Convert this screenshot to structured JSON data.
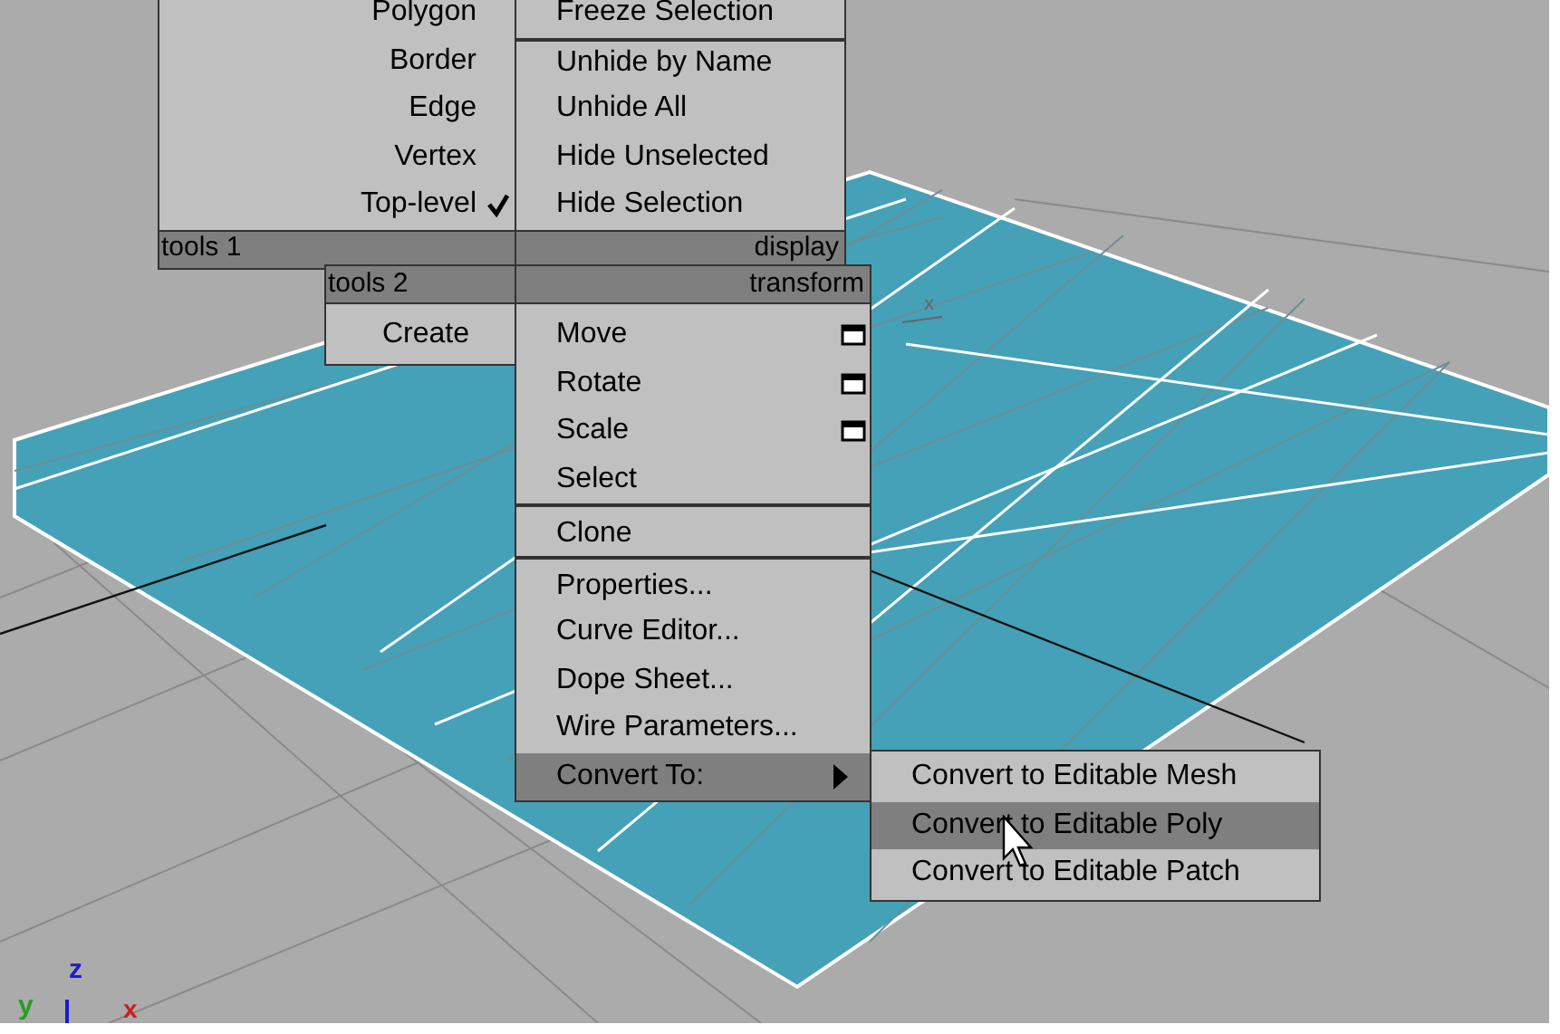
{
  "quad_menu": {
    "tools_1": {
      "header": "tools 1",
      "items": [
        {
          "label": "Polygon",
          "checked": false
        },
        {
          "label": "Border",
          "checked": false
        },
        {
          "label": "Edge",
          "checked": false
        },
        {
          "label": "Vertex",
          "checked": false
        },
        {
          "label": "Top-level",
          "checked": true
        }
      ]
    },
    "display": {
      "header": "display",
      "items": [
        {
          "label": "Freeze Selection",
          "separator_before": false
        },
        {
          "label": "Unhide by Name",
          "separator_before": true
        },
        {
          "label": "Unhide All",
          "separator_before": false
        },
        {
          "label": "Hide Unselected",
          "separator_before": false
        },
        {
          "label": "Hide Selection",
          "separator_before": false
        }
      ]
    },
    "tools_2": {
      "header": "tools 2",
      "items": [
        {
          "label": "Create"
        }
      ]
    },
    "transform": {
      "header": "transform",
      "items": [
        {
          "label": "Move",
          "options": true,
          "separator_before": false,
          "submenu": false,
          "selected": false
        },
        {
          "label": "Rotate",
          "options": true,
          "separator_before": false,
          "submenu": false,
          "selected": false
        },
        {
          "label": "Scale",
          "options": true,
          "separator_before": false,
          "submenu": false,
          "selected": false
        },
        {
          "label": "Select",
          "options": false,
          "separator_before": false,
          "submenu": false,
          "selected": false
        },
        {
          "label": "Clone",
          "options": false,
          "separator_before": true,
          "submenu": false,
          "selected": false
        },
        {
          "label": "Properties...",
          "options": false,
          "separator_before": true,
          "submenu": false,
          "selected": false
        },
        {
          "label": "Curve Editor...",
          "options": false,
          "separator_before": false,
          "submenu": false,
          "selected": false
        },
        {
          "label": "Dope Sheet...",
          "options": false,
          "separator_before": false,
          "submenu": false,
          "selected": false
        },
        {
          "label": "Wire Parameters...",
          "options": false,
          "separator_before": false,
          "submenu": false,
          "selected": false
        },
        {
          "label": "Convert To:",
          "options": false,
          "separator_before": false,
          "submenu": true,
          "selected": true
        }
      ]
    },
    "convert_submenu": [
      {
        "label": "Convert to Editable Mesh",
        "selected": false
      },
      {
        "label": "Convert to Editable Poly",
        "selected": true
      },
      {
        "label": "Convert to Editable Patch",
        "selected": false
      }
    ]
  },
  "viewport": {
    "gizmo_label": "x",
    "axis_labels": {
      "z": "z",
      "y": "y",
      "x": "x"
    }
  }
}
